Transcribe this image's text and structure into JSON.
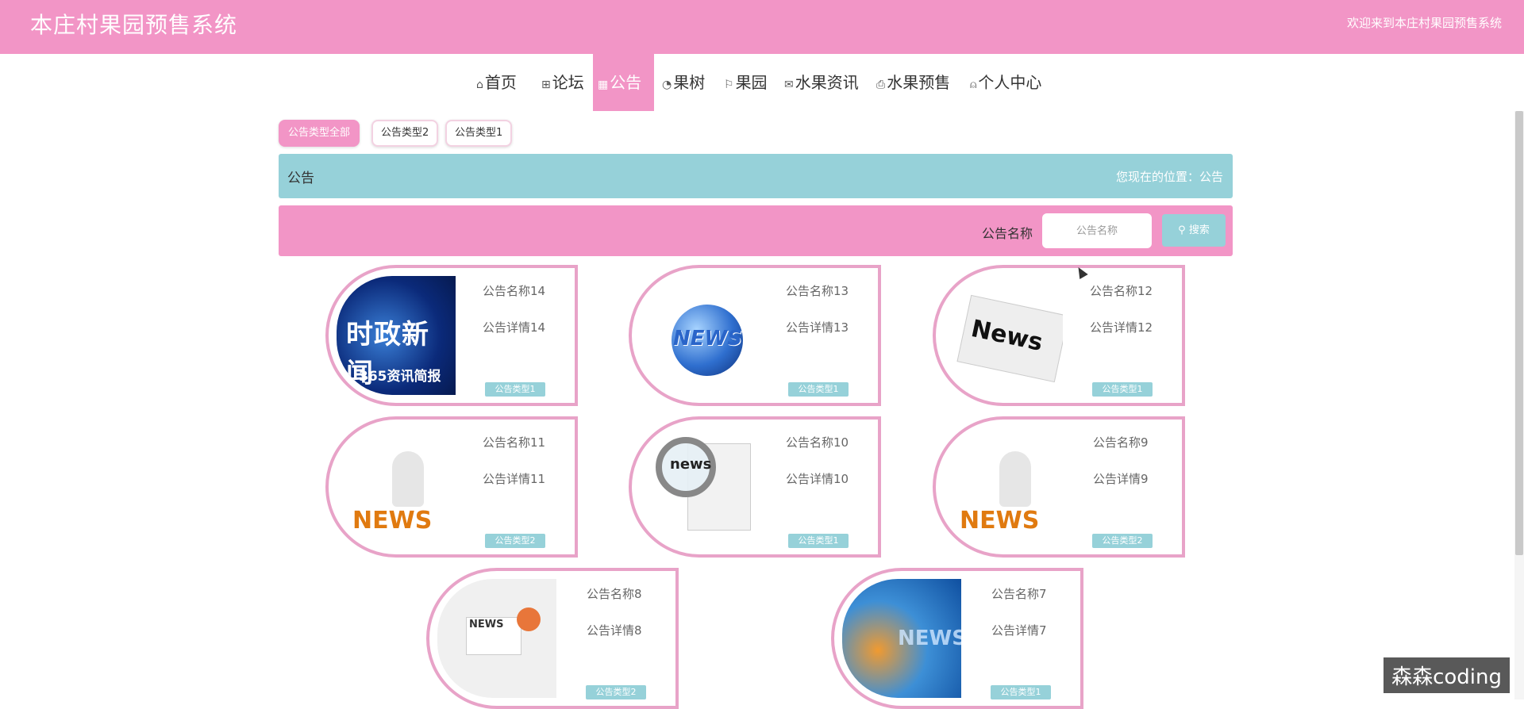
{
  "header": {
    "title": "本庄村果园预售系统",
    "welcome": "欢迎来到本庄村果园预售系统"
  },
  "nav": {
    "items": [
      {
        "label": "首页",
        "icon": "home-icon"
      },
      {
        "label": "论坛",
        "icon": "forum-icon"
      },
      {
        "label": "公告",
        "icon": "notice-icon",
        "active": true
      },
      {
        "label": "果树",
        "icon": "tree-icon"
      },
      {
        "label": "果园",
        "icon": "flag-icon"
      },
      {
        "label": "水果资讯",
        "icon": "mail-icon"
      },
      {
        "label": "水果预售",
        "icon": "printer-icon"
      },
      {
        "label": "个人中心",
        "icon": "user-icon"
      }
    ]
  },
  "filters": {
    "all": "公告类型全部",
    "type2": "公告类型2",
    "type1": "公告类型1"
  },
  "titlebar": {
    "title": "公告",
    "location": "您现在的位置：公告"
  },
  "search": {
    "label": "公告名称",
    "placeholder": "公告名称",
    "button": "搜索"
  },
  "cards": [
    {
      "name": "公告名称14",
      "detail": "公告详情14",
      "type": "公告类型1",
      "thumb_text": "时政新闻",
      "thumb_sub": "365资讯简报"
    },
    {
      "name": "公告名称13",
      "detail": "公告详情13",
      "type": "公告类型1",
      "thumb_text": "NEWS"
    },
    {
      "name": "公告名称12",
      "detail": "公告详情12",
      "type": "公告类型1",
      "thumb_text": "News"
    },
    {
      "name": "公告名称11",
      "detail": "公告详情11",
      "type": "公告类型2",
      "thumb_text": "NEWS"
    },
    {
      "name": "公告名称10",
      "detail": "公告详情10",
      "type": "公告类型1",
      "thumb_text": "news"
    },
    {
      "name": "公告名称9",
      "detail": "公告详情9",
      "type": "公告类型2",
      "thumb_text": "NEWS"
    },
    {
      "name": "公告名称8",
      "detail": "公告详情8",
      "type": "公告类型2",
      "thumb_text": "NEWS"
    },
    {
      "name": "公告名称7",
      "detail": "公告详情7",
      "type": "公告类型1",
      "thumb_text": "NEWS"
    }
  ],
  "watermark": "森森coding",
  "colors": {
    "pink": "#f295c6",
    "teal": "#96d1d9",
    "card_border": "#e8a3c8"
  }
}
